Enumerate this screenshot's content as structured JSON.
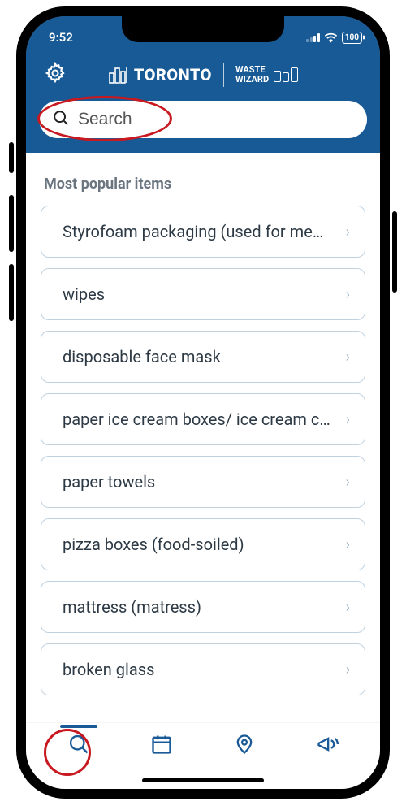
{
  "status": {
    "time": "9:52",
    "battery": "100"
  },
  "header": {
    "brand_city": "TORONTO",
    "brand_app_line1": "WASTE",
    "brand_app_line2": "WIZARD"
  },
  "search": {
    "placeholder": "Search"
  },
  "section_title": "Most popular items",
  "items": [
    {
      "label": "Styrofoam packaging (used for meat, take-out)"
    },
    {
      "label": "wipes"
    },
    {
      "label": "disposable face mask"
    },
    {
      "label": "paper ice cream boxes/ ice cream cartons"
    },
    {
      "label": "paper towels"
    },
    {
      "label": "pizza boxes (food-soiled)"
    },
    {
      "label": "mattress (matress)"
    },
    {
      "label": "broken glass"
    }
  ],
  "nav": {
    "search": "search",
    "calendar": "calendar",
    "map": "map",
    "announce": "announcements"
  }
}
